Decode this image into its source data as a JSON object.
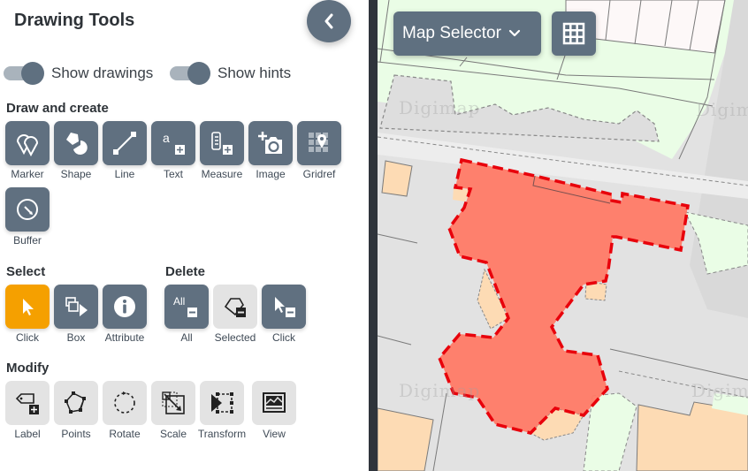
{
  "panel": {
    "title": "Drawing Tools",
    "collapse_icon": "chevron-left-icon",
    "toggles": [
      {
        "label": "Show drawings",
        "on": true
      },
      {
        "label": "Show hints",
        "on": true
      }
    ],
    "sections": {
      "draw": {
        "title": "Draw and create",
        "tools": [
          {
            "label": "Marker",
            "icon": "marker-icon"
          },
          {
            "label": "Shape",
            "icon": "shape-icon"
          },
          {
            "label": "Line",
            "icon": "line-icon"
          },
          {
            "label": "Text",
            "icon": "text-add-icon",
            "glyph": "a"
          },
          {
            "label": "Measure",
            "icon": "measure-icon"
          },
          {
            "label": "Image",
            "icon": "add-image-icon"
          },
          {
            "label": "Gridref",
            "icon": "gridref-icon"
          },
          {
            "label": "Buffer",
            "icon": "buffer-icon"
          }
        ]
      },
      "select": {
        "title": "Select",
        "tools": [
          {
            "label": "Click",
            "icon": "cursor-icon",
            "active": true
          },
          {
            "label": "Box",
            "icon": "box-select-icon"
          },
          {
            "label": "Attribute",
            "icon": "info-icon"
          }
        ]
      },
      "delete": {
        "title": "Delete",
        "tools": [
          {
            "label": "All",
            "icon": "delete-all-icon",
            "glyph": "All"
          },
          {
            "label": "Selected",
            "icon": "delete-selected-icon",
            "disabled": true
          },
          {
            "label": "Click",
            "icon": "delete-click-icon"
          }
        ]
      },
      "modify": {
        "title": "Modify",
        "tools": [
          {
            "label": "Label",
            "icon": "label-icon"
          },
          {
            "label": "Points",
            "icon": "points-icon"
          },
          {
            "label": "Rotate",
            "icon": "rotate-icon"
          },
          {
            "label": "Scale",
            "icon": "scale-icon"
          },
          {
            "label": "Transform",
            "icon": "transform-icon"
          },
          {
            "label": "View",
            "icon": "view-icon"
          }
        ]
      }
    }
  },
  "map": {
    "selector_label": "Map Selector",
    "selector_icon": "chevron-down-icon",
    "grid_button_icon": "grid-icon",
    "watermark": "Digimap",
    "colors": {
      "drawing_fill": "#ff7a66",
      "drawing_stroke": "#e8000b",
      "building": "#fddbb4",
      "green": "#eafde6",
      "road": "#e2e2e2"
    }
  }
}
